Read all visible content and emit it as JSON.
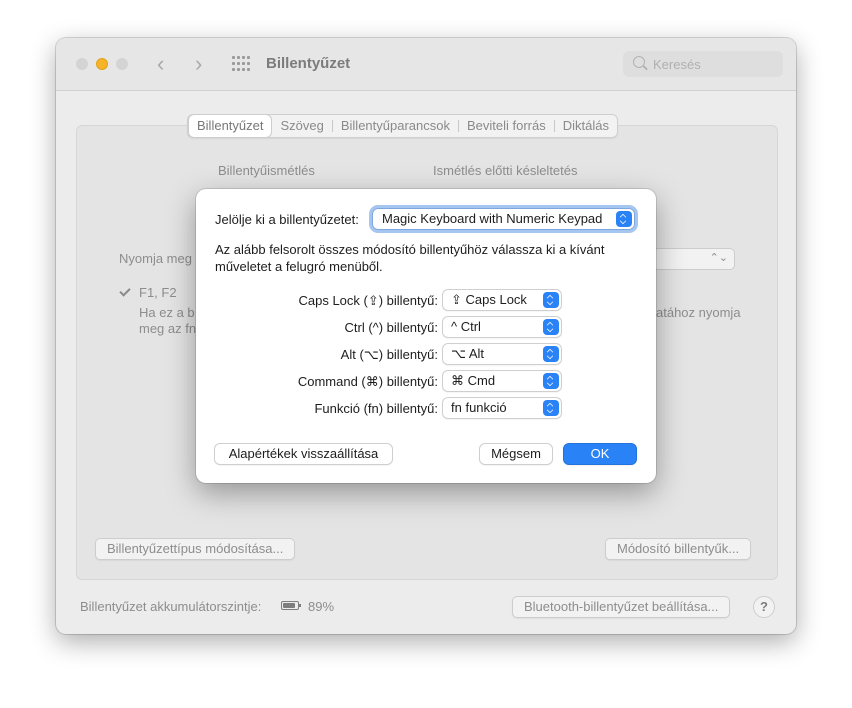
{
  "window": {
    "title": "Billentyűzet",
    "search_placeholder": "Keresés",
    "nav_back": "‹",
    "nav_forward": "›",
    "traffic_lights": {
      "close": "#d4d4d4",
      "minimize": "#f6b426",
      "zoom": "#d4d4d4"
    }
  },
  "tabs": [
    {
      "label": "Billentyűzet",
      "selected": true
    },
    {
      "label": "Szöveg",
      "selected": false
    },
    {
      "label": "Billentyűparancsok",
      "selected": false
    },
    {
      "label": "Beviteli forrás",
      "selected": false
    },
    {
      "label": "Diktálás",
      "selected": false
    }
  ],
  "background": {
    "key_repeat_label": "Billentyűismétlés",
    "delay_label": "Ismétlés előtti késleltetés",
    "press_label": "Nyomja meg",
    "fn_checkbox_label": "F1, F2",
    "fn_desc_line1": "Ha ez a b",
    "fn_desc_line2": "meg az fn",
    "fn_desc_right": "atához nyomja",
    "change_type_button": "Billentyűzettípus módosítása...",
    "modifier_keys_button": "Módosító billentyűk...",
    "battery_label": "Billentyűzet akkumulátorszintje:",
    "battery_value": "89%",
    "bluetooth_button": "Bluetooth-billentyűzet beállítása...",
    "help": "?"
  },
  "dialog": {
    "select_keyboard_label": "Jelölje ki a billentyűzetet:",
    "selected_keyboard": "Magic Keyboard with Numeric Keypad",
    "instructions_line1": "Az alább felsorolt összes módosító billentyűhöz válassza ki a kívánt",
    "instructions_line2": "műveletet a felugró menüből.",
    "rows": [
      {
        "label": "Caps Lock (⇪) billentyű:",
        "value": "⇪ Caps Lock"
      },
      {
        "label": "Ctrl (^) billentyű:",
        "value": "^ Ctrl"
      },
      {
        "label": "Alt (⌥) billentyű:",
        "value": "⌥ Alt"
      },
      {
        "label": "Command (⌘) billentyű:",
        "value": "⌘ Cmd"
      },
      {
        "label": "Funkció (fn) billentyű:",
        "value": "fn funkció"
      }
    ],
    "restore_defaults_button": "Alapértékek visszaállítása",
    "cancel_button": "Mégsem",
    "ok_button": "OK",
    "accent_color": "#2a83f6"
  }
}
